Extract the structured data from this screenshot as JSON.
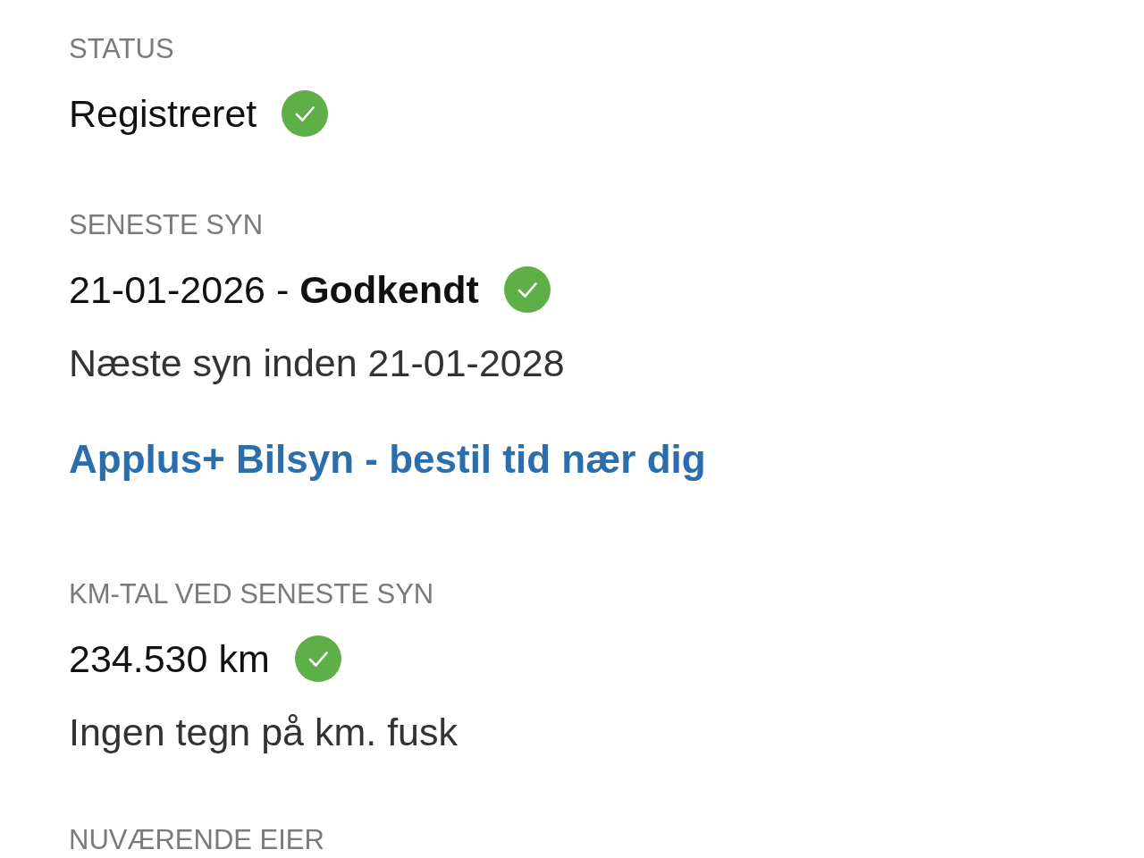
{
  "sections": [
    {
      "label": "STATUS",
      "lines": [
        {
          "kind": "value",
          "text": "Registreret",
          "verified": true
        }
      ]
    },
    {
      "label": "SENESTE SYN",
      "lines": [
        {
          "kind": "value",
          "text": "21-01-2026 - **Godkendt**",
          "verified": true
        },
        {
          "kind": "note",
          "text": "Næste syn inden 21-01-2028"
        },
        {
          "kind": "link",
          "text": "Applus+ Bilsyn - bestil tid nær dig"
        }
      ]
    },
    {
      "label": "KM-TAL VED SENESTE SYN",
      "lines": [
        {
          "kind": "value",
          "text": "234.530 km",
          "verified": true
        },
        {
          "kind": "note",
          "text": "Ingen tegn på km. fusk"
        }
      ]
    },
    {
      "label": "NUVÆRENDE EIER"
    }
  ]
}
